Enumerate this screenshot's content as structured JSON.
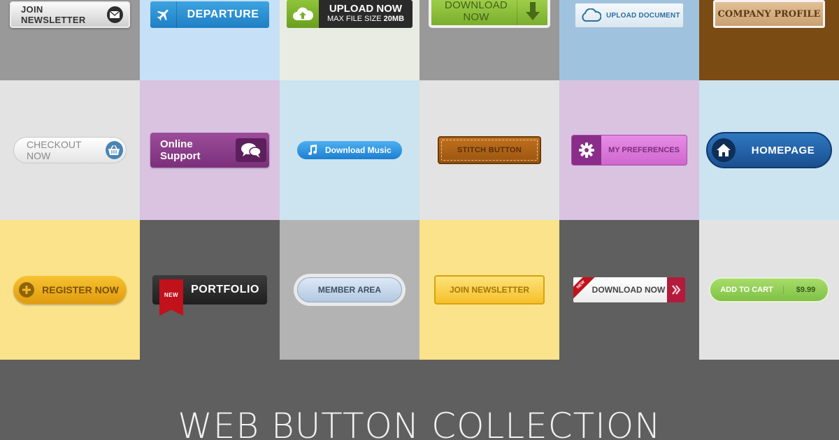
{
  "grid": {
    "rows": [
      {
        "colors": [
          "#999999",
          "#c6e1f7",
          "#e9ece2",
          "#999999",
          "#9fc3df",
          "#7a4b12"
        ]
      },
      {
        "colors": [
          "#e3e3e3",
          "#d9c3e0",
          "#cce3f0",
          "#e3e3e3",
          "#d9c3e0",
          "#cce3f0"
        ]
      },
      {
        "colors": [
          "#fae38a",
          "#5f5f5f",
          "#b3b3b3",
          "#fae38a",
          "#5f5f5f",
          "#e3e3e3"
        ]
      }
    ]
  },
  "buttons": {
    "join_newsletter": {
      "label": "JOIN NEWSLETTER",
      "icon": "envelope-icon"
    },
    "departure": {
      "label": "DEPARTURE",
      "icon": "airplane-icon"
    },
    "upload_now": {
      "label": "UPLOAD NOW",
      "sublabel_prefix": "MAX FILE SIZE",
      "sublabel_bold": "20MB",
      "icon": "cloud-upload-icon"
    },
    "download_now_green": {
      "label": "DOWNLOAD NOW",
      "icon": "arrow-down-icon"
    },
    "upload_document": {
      "label": "UPLOAD DOCUMENT",
      "icon": "cloud-icon"
    },
    "company_profile": {
      "label": "COMPANY PROFILE"
    },
    "checkout_now": {
      "label": "CHECKOUT NOW",
      "icon": "basket-icon"
    },
    "online_support": {
      "label": "Online Support",
      "icon": "chat-bubbles-icon"
    },
    "download_music": {
      "label": "Download Music",
      "icon": "music-note-icon"
    },
    "stitch_button": {
      "label": "STITCH BUTTON"
    },
    "my_preferences": {
      "label": "MY PREFERENCES",
      "icon": "gear-icon"
    },
    "homepage": {
      "label": "HOMEPAGE",
      "icon": "home-icon"
    },
    "register_now": {
      "label": "REGISTER NOW",
      "icon": "plus-icon"
    },
    "portfolio": {
      "label": "PORTFOLIO",
      "badge": "NEW"
    },
    "member_area": {
      "label": "MEMBER AREA"
    },
    "join_newsletter_yellow": {
      "label": "JOIN NEWSLETTER"
    },
    "download_now_ribbon": {
      "label": "DOWNLOAD NOW",
      "badge": "NEW",
      "icon": "double-chevron-right-icon"
    },
    "add_to_cart": {
      "label": "ADD TO CART",
      "price": "$9.99"
    }
  },
  "footer": {
    "title": "WEB BUTTON COLLECTION"
  }
}
